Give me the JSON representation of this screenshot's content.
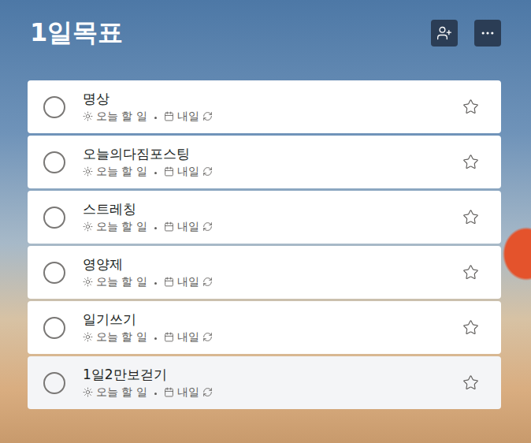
{
  "list": {
    "title": "1일목표"
  },
  "tasks": [
    {
      "title": "명상",
      "my_day": "오늘 할 일",
      "due": "내일",
      "repeat": true,
      "completed": false,
      "important": false,
      "highlighted": false
    },
    {
      "title": "오늘의다짐포스팅",
      "my_day": "오늘 할 일",
      "due": "내일",
      "repeat": true,
      "completed": false,
      "important": false,
      "highlighted": false
    },
    {
      "title": "스트레칭",
      "my_day": "오늘 할 일",
      "due": "내일",
      "repeat": true,
      "completed": false,
      "important": false,
      "highlighted": false
    },
    {
      "title": "영양제",
      "my_day": "오늘 할 일",
      "due": "내일",
      "repeat": true,
      "completed": false,
      "important": false,
      "highlighted": false
    },
    {
      "title": "일기쓰기",
      "my_day": "오늘 할 일",
      "due": "내일",
      "repeat": true,
      "completed": false,
      "important": false,
      "highlighted": false
    },
    {
      "title": "1일2만보걷기",
      "my_day": "오늘 할 일",
      "due": "내일",
      "repeat": true,
      "completed": false,
      "important": false,
      "highlighted": true
    }
  ]
}
